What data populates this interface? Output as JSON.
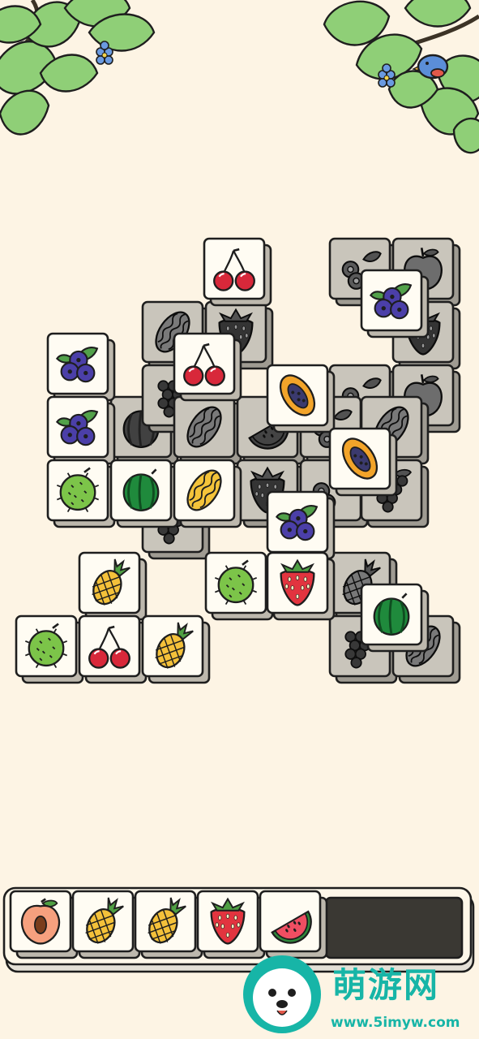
{
  "board": {
    "tiles": [
      {
        "id": "b1",
        "fruit": "kiwi",
        "dim": true
      },
      {
        "id": "b2",
        "fruit": "apple",
        "dim": true
      },
      {
        "id": "b3",
        "fruit": "melon",
        "dim": true
      },
      {
        "id": "b4",
        "fruit": "strawberry",
        "dim": true
      },
      {
        "id": "b5",
        "fruit": "strawberry",
        "dim": true
      },
      {
        "id": "b6",
        "fruit": "kiwi",
        "dim": true
      },
      {
        "id": "b7",
        "fruit": "apple",
        "dim": true
      },
      {
        "id": "b8",
        "fruit": "watermelon",
        "dim": true
      },
      {
        "id": "b9",
        "fruit": "grapes",
        "dim": true
      },
      {
        "id": "b10",
        "fruit": "melon",
        "dim": true
      },
      {
        "id": "b11",
        "fruit": "watermelon-slice",
        "dim": true
      },
      {
        "id": "b12",
        "fruit": "kiwi",
        "dim": true
      },
      {
        "id": "b13",
        "fruit": "melon",
        "dim": true
      },
      {
        "id": "b14",
        "fruit": "strawberry",
        "dim": true
      },
      {
        "id": "b15",
        "fruit": "kiwi",
        "dim": true
      },
      {
        "id": "b16",
        "fruit": "grapes",
        "dim": true
      },
      {
        "id": "b17",
        "fruit": "grapes",
        "dim": true
      },
      {
        "id": "b18",
        "fruit": "pineapple",
        "dim": true
      },
      {
        "id": "b19",
        "fruit": "grapes",
        "dim": true
      },
      {
        "id": "b20",
        "fruit": "melon",
        "dim": true
      },
      {
        "id": "t1",
        "fruit": "cherry",
        "dim": false
      },
      {
        "id": "t2",
        "fruit": "blueberry",
        "dim": false
      },
      {
        "id": "t3",
        "fruit": "blueberry",
        "dim": false
      },
      {
        "id": "t4",
        "fruit": "cherry",
        "dim": false
      },
      {
        "id": "t5",
        "fruit": "blueberry",
        "dim": false
      },
      {
        "id": "t6",
        "fruit": "papaya",
        "dim": false
      },
      {
        "id": "t7",
        "fruit": "papaya",
        "dim": false
      },
      {
        "id": "t8",
        "fruit": "durian",
        "dim": false
      },
      {
        "id": "t9",
        "fruit": "watermelon",
        "dim": false
      },
      {
        "id": "t10",
        "fruit": "melon",
        "dim": false
      },
      {
        "id": "t11",
        "fruit": "blueberry",
        "dim": false
      },
      {
        "id": "t12",
        "fruit": "pineapple",
        "dim": false
      },
      {
        "id": "t13",
        "fruit": "durian",
        "dim": false
      },
      {
        "id": "t14",
        "fruit": "strawberry",
        "dim": false
      },
      {
        "id": "t15",
        "fruit": "watermelon",
        "dim": false
      },
      {
        "id": "t16",
        "fruit": "durian",
        "dim": false
      },
      {
        "id": "t17",
        "fruit": "cherry",
        "dim": false
      },
      {
        "id": "t18",
        "fruit": "pineapple",
        "dim": false
      }
    ]
  },
  "tray": {
    "capacity": 7,
    "slots": [
      "peach",
      "pineapple",
      "pineapple",
      "strawberry",
      "watermelon-slice"
    ]
  },
  "watermark": {
    "brand": "萌游网",
    "url": "www.5imyw.com"
  },
  "colors": {
    "background": "#fdf4e4",
    "tile_face": "#fffcf3",
    "tile_side": "#bdb8ad",
    "leaf": "#8fcf77",
    "watermark": "#17b5a7"
  }
}
